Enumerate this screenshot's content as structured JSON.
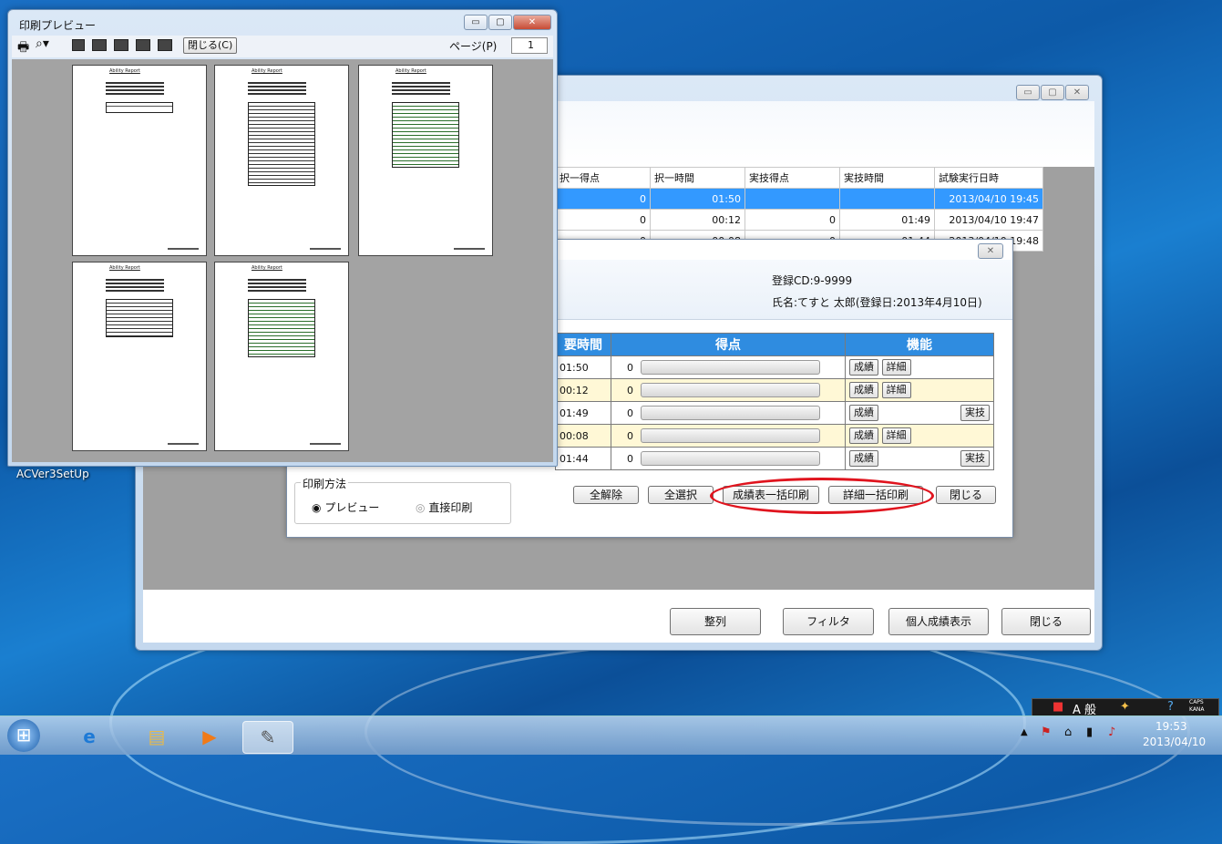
{
  "desktop": {
    "icon_label": "ACVer3SetUp"
  },
  "main_window": {
    "columns": [
      "択一得点",
      "択一時間",
      "実技得点",
      "実技時間",
      "試験実行日時"
    ],
    "rows": [
      [
        "0",
        "01:50",
        "",
        "",
        "2013/04/10 19:45"
      ],
      [
        "0",
        "00:12",
        "0",
        "01:49",
        "2013/04/10 19:47"
      ],
      [
        "0",
        "00:08",
        "0",
        "01:44",
        "2013/04/10 19:48"
      ]
    ],
    "buttons": {
      "sort": "整列",
      "filter": "フィルタ",
      "personal": "個人成績表示",
      "close": "閉じる"
    }
  },
  "score_dialog": {
    "close_glyph": "✕",
    "reg_cd": "登録CD:9-9999",
    "name": "氏名:てすと 太郎(登録日:2013年4月10日)",
    "headers": {
      "time": "要時間",
      "score": "得点",
      "function": "機能"
    },
    "rows": [
      {
        "time": "01:50",
        "score": "0",
        "detail": "詳細",
        "jitsugi": ""
      },
      {
        "time": "00:12",
        "score": "0",
        "detail": "詳細",
        "jitsugi": ""
      },
      {
        "time": "01:49",
        "score": "0",
        "detail": "",
        "jitsugi": "実技"
      },
      {
        "time": "00:08",
        "score": "0",
        "detail": "詳細",
        "jitsugi": ""
      },
      {
        "time": "01:44",
        "score": "0",
        "detail": "",
        "jitsugi": "実技"
      }
    ],
    "seiseki_label": "成績",
    "print_method_label": "印刷方法",
    "radio_preview": "プレビュー",
    "radio_direct": "直接印刷",
    "buttons": {
      "clear_all": "全解除",
      "select_all": "全選択",
      "batch_score_print": "成績表一括印刷",
      "batch_detail_print": "詳細一括印刷",
      "close": "閉じる"
    }
  },
  "preview_window": {
    "title": "印刷プレビュー",
    "close_label": "閉じる(C)",
    "page_label": "ページ(P)",
    "page_value": "1",
    "page_thumb_title": "Ability Report"
  },
  "taskbar": {
    "time": "19:53",
    "date": "2013/04/10",
    "ime_text": "A 般",
    "caps": "CAPS",
    "kana": "KANA"
  },
  "colors": {
    "highlight_circle": "#e0141e",
    "selected_row": "#3399ff",
    "header_blue": "#2f8ce0",
    "stripe": "#fff8d6"
  }
}
